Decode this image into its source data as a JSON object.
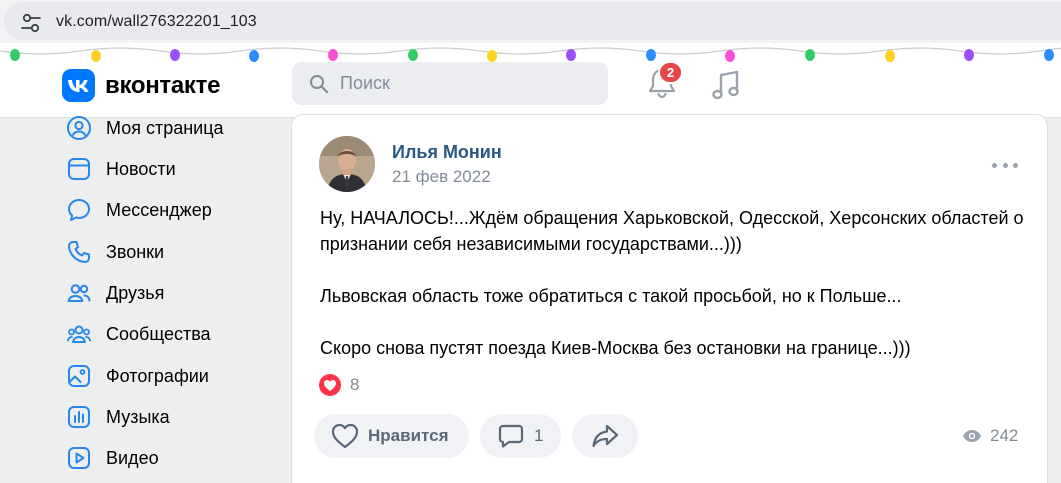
{
  "browser": {
    "url": "vk.com/wall276322201_103",
    "icons": {
      "site_info": "tune-icon"
    }
  },
  "header": {
    "logo_text": "вконтакте",
    "search_placeholder": "Поиск",
    "notifications_badge": "2",
    "icons": {
      "search": "search-icon",
      "notifications": "bell-icon",
      "music": "music-note-icon"
    },
    "accent_color": "#0077ff"
  },
  "sidebar": {
    "items": [
      {
        "label": "Моя страница",
        "icon": "user-circle-icon"
      },
      {
        "label": "Новости",
        "icon": "news-icon"
      },
      {
        "label": "Мессенджер",
        "icon": "message-icon"
      },
      {
        "label": "Звонки",
        "icon": "phone-icon"
      },
      {
        "label": "Друзья",
        "icon": "friends-icon"
      },
      {
        "label": "Сообщества",
        "icon": "communities-icon"
      },
      {
        "label": "Фотографии",
        "icon": "photo-icon"
      },
      {
        "label": "Музыка",
        "icon": "music-icon"
      },
      {
        "label": "Видео",
        "icon": "video-icon"
      }
    ]
  },
  "post": {
    "author": "Илья Монин",
    "date": "21 фев 2022",
    "paragraphs": [
      "Ну, НАЧАЛОСЬ!...Ждём обращения Харьковской, Одесской, Херсонских областей о признании себя независимыми государствами...)))",
      "Львовская область тоже обратиться с такой просьбой, но к Польше...",
      "Скоро снова пустят поезда Киев-Москва без остановки на границе...)))"
    ],
    "reactions_count": "8",
    "like_label": "Нравится",
    "comments_count": "1",
    "views_count": "242",
    "colors": {
      "author": "#2a5885",
      "reaction": "#ff3347"
    }
  }
}
